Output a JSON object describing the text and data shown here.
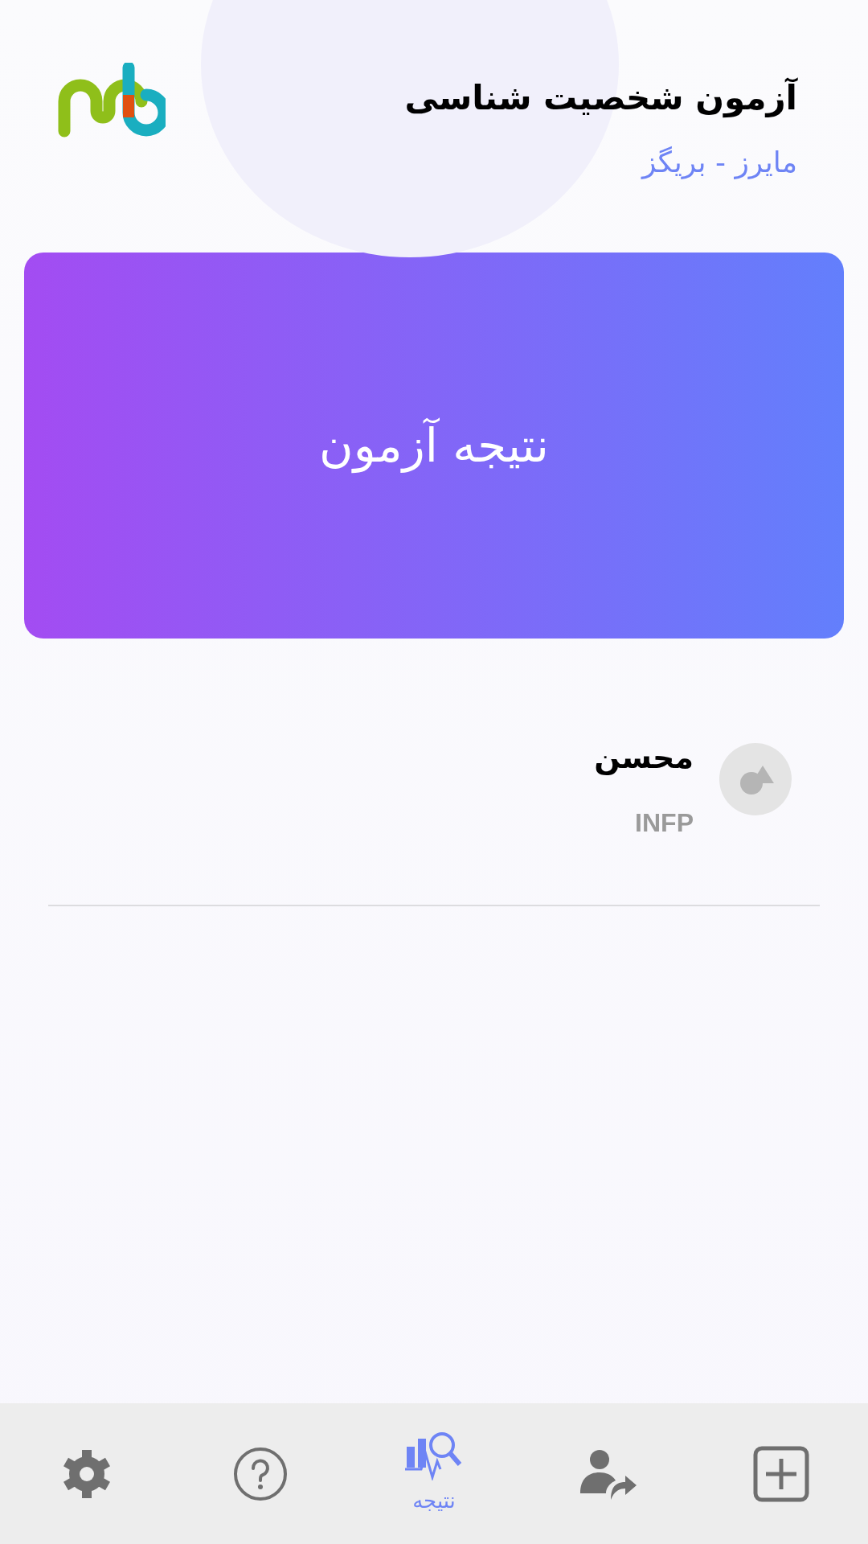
{
  "header": {
    "title": "آزمون شخصیت شناسی",
    "subtitle": "مایرز - بریگز"
  },
  "result_card": {
    "label": "نتیجه آزمون"
  },
  "results": [
    {
      "name": "محسن",
      "type": "INFP"
    }
  ],
  "bottom_nav": [
    {
      "kind": "add",
      "selected": false
    },
    {
      "kind": "share",
      "selected": false
    },
    {
      "kind": "result",
      "selected": true,
      "label": "نتیجه"
    },
    {
      "kind": "help",
      "selected": false
    },
    {
      "kind": "settings",
      "selected": false
    }
  ]
}
